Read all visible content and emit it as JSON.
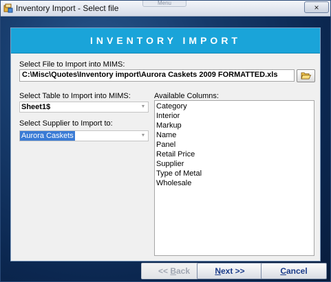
{
  "window": {
    "title": "Inventory Import - Select file",
    "close_glyph": "×",
    "ghost_tab_text": "Menu"
  },
  "banner": {
    "title": "INVENTORY IMPORT"
  },
  "file": {
    "label": "Select File to Import into MIMS:",
    "path": "C:\\Misc\\Quotes\\Inventory import\\Aurora Caskets 2009 FORMATTED.xls",
    "browse_icon": "folder-open-icon"
  },
  "table": {
    "label": "Select Table to Import into MIMS:",
    "value": "Sheet1$"
  },
  "supplier": {
    "label": "Select Supplier to Import to:",
    "value": "Aurora Caskets"
  },
  "columns": {
    "label": "Available Columns:",
    "items": [
      "Category",
      "Interior",
      "Markup",
      "Name",
      "Panel",
      "Retail Price",
      "Supplier",
      "Type of Metal",
      "Wholesale"
    ]
  },
  "buttons": {
    "back": {
      "prefix": "<< ",
      "underline": "B",
      "rest": "ack",
      "enabled": false
    },
    "next": {
      "underline": "N",
      "rest": "ext >>"
    },
    "cancel": {
      "underline": "C",
      "rest": "ancel"
    }
  },
  "colors": {
    "banner": "#1aa4d9",
    "background": "#0d2a55",
    "selection": "#3a7bd5",
    "button_text": "#1a3b8a"
  }
}
